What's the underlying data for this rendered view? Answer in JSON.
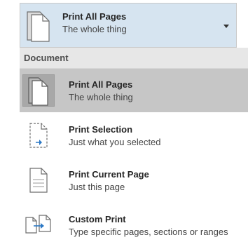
{
  "dropdown": {
    "title": "Print All Pages",
    "subtitle": "The whole thing",
    "icon": "print-all-pages-icon"
  },
  "menu": {
    "section_header": "Document",
    "items": [
      {
        "title": "Print All Pages",
        "subtitle": "The whole thing",
        "icon": "print-all-pages-icon",
        "selected": true
      },
      {
        "title": "Print Selection",
        "subtitle": "Just what you selected",
        "icon": "print-selection-icon",
        "selected": false
      },
      {
        "title": "Print Current Page",
        "subtitle": "Just this page",
        "icon": "print-current-page-icon",
        "selected": false
      },
      {
        "title": "Custom Print",
        "subtitle": "Type specific pages, sections or ranges",
        "icon": "custom-print-icon",
        "selected": false
      }
    ]
  },
  "colors": {
    "dropdown_background": "#d6e4f0",
    "selected_item_background": "#c6c6c6",
    "header_background": "#e7e7e7",
    "accent_blue": "#2b78c5"
  }
}
